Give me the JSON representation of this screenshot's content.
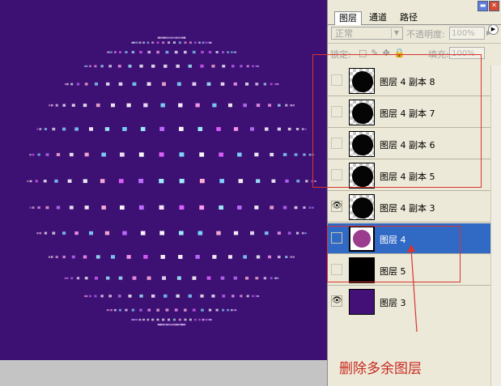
{
  "panel": {
    "tabs": [
      "图层",
      "通道",
      "路径"
    ],
    "blend_mode": "正常",
    "opacity_label": "不透明度:",
    "opacity_value": "100%",
    "lock_label": "锁定:",
    "fill_label": "填充:",
    "fill_value": "100%"
  },
  "layers": [
    {
      "name": "图层 4 副本 8",
      "visible": false,
      "thumb": "black-ball",
      "selected": false
    },
    {
      "name": "图层 4 副本 7",
      "visible": false,
      "thumb": "black-ball",
      "selected": false
    },
    {
      "name": "图层 4 副本 6",
      "visible": false,
      "thumb": "black-ball",
      "selected": false
    },
    {
      "name": "图层 4 副本 5",
      "visible": false,
      "thumb": "black-ball",
      "selected": false
    },
    {
      "name": "图层 4 副本 3",
      "visible": true,
      "thumb": "black-ball",
      "selected": false
    },
    {
      "name": "图层 4",
      "visible": false,
      "thumb": "purple-ball",
      "selected": true
    },
    {
      "name": "图层 5",
      "visible": false,
      "thumb": "black",
      "selected": false
    },
    {
      "name": "图层 3",
      "visible": true,
      "thumb": "purple",
      "selected": false
    }
  ],
  "annotation": "删除多余图层",
  "colors": {
    "canvas_bg": "#3d1073",
    "accent_red": "#d9352f",
    "selected_row": "#316ac5"
  }
}
